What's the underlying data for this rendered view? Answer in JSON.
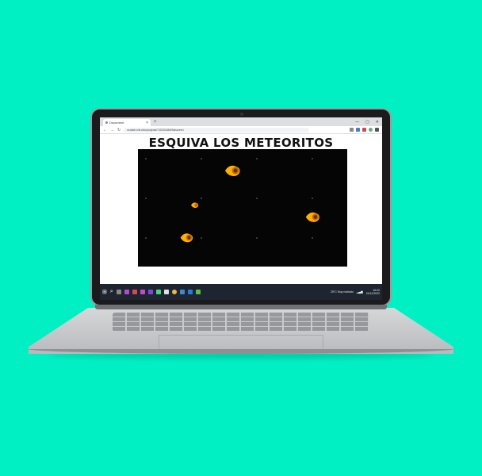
{
  "browser": {
    "tab_title": "Document",
    "tab_close": "×",
    "new_tab": "+",
    "url": "scratch.mit.edu/projects/710234469/fullscreen",
    "window_controls": [
      "—",
      "▢",
      "✕"
    ]
  },
  "game": {
    "title": "ESQUIVA LOS METEORITOS",
    "meteors": [
      {
        "name": "meteor-1"
      },
      {
        "name": "meteor-2"
      },
      {
        "name": "meteor-3"
      },
      {
        "name": "meteor-4"
      }
    ]
  },
  "taskbar": {
    "start_icon": "⊞",
    "search_icon": "⌕",
    "weather": "25°C  Muy nublado",
    "time": "16:02",
    "date": "24/11/2022"
  },
  "colors": {
    "background": "#00f0c4",
    "canvas": "#050505",
    "meteor_fire": "#ffb000"
  }
}
